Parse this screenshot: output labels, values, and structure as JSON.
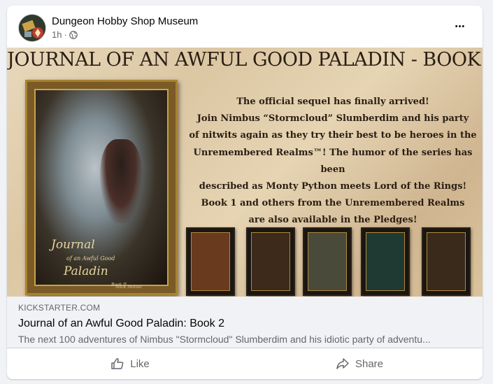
{
  "post": {
    "page_name": "Dungeon Hobby Shop Museum",
    "time": "1h",
    "separator": "·",
    "audience_icon": "globe-icon",
    "more_label": "•••"
  },
  "banner": {
    "title": "JOURNAL OF AN AWFUL GOOD PALADIN - BOOK 2",
    "promo_lines": [
      "The official sequel has finally arrived!",
      "Join Nimbus “Stormcloud” Slumberdim and his party",
      "of nitwits again as they try their best to be heroes in the",
      "Unremembered Realms™! The humor of the series has been",
      "described as Monty Python meets Lord of the Rings!",
      "Book 1 and others from the Unremembered Realms",
      "are also available in the Pledges!"
    ],
    "cover": {
      "title_line1": "Journal",
      "subtitle": "of an Awful Good",
      "title_line2": "Paladin",
      "book_number": "Book II",
      "author": "Mick Motter"
    },
    "thumbnail_colors": [
      "#6a3a1e",
      "#3d2a1a",
      "#4a4a3a",
      "#1f3a32",
      "#3a2a1c"
    ]
  },
  "link": {
    "domain": "KICKSTARTER.COM",
    "title": "Journal of an Awful Good Paladin: Book 2",
    "description": "The next 100 adventures of Nimbus \"Stormcloud\" Slumberdim and his idiotic party of adventu..."
  },
  "actions": {
    "like_label": "Like",
    "share_label": "Share"
  },
  "colors": {
    "background": "#f0f2f5",
    "card": "#ffffff",
    "secondary_text": "#65676b",
    "primary_text": "#050505"
  }
}
